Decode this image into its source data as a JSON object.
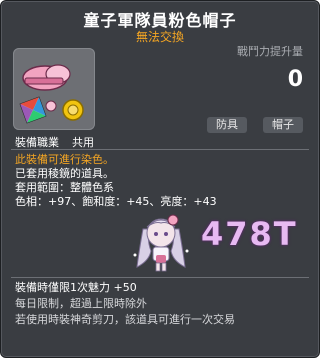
{
  "item": {
    "name": "童子軍隊員粉色帽子",
    "trade_status": "無法交換",
    "combat_power_label": "戰鬥力提升量",
    "combat_power_value": "0",
    "job_label": "裝備職業",
    "job_value": "共用",
    "tags": [
      "防具",
      "帽子"
    ],
    "desc_lines": [
      "此裝備可進行染色。",
      "已套用稜鏡的道具。",
      "套用範圍：整體色系",
      "色相：+97、飽和度：+45、亮度：+43"
    ],
    "overlay_text": "478T",
    "bottom_lines": [
      "裝備時僅限1次魅力  +50",
      "每日限制，超過上限時除外",
      "若使用時裝神奇剪刀，該道具可進行一次交易"
    ]
  },
  "colors": {
    "title": "#ffffff",
    "trade_status": "#f5a623",
    "background": "#3a3d42",
    "dye_line": "#f5a623",
    "overlay_text": "#e7b9f2"
  },
  "icons": {
    "item_icon": "pink-hat-icon",
    "avatar": "character-avatar"
  }
}
